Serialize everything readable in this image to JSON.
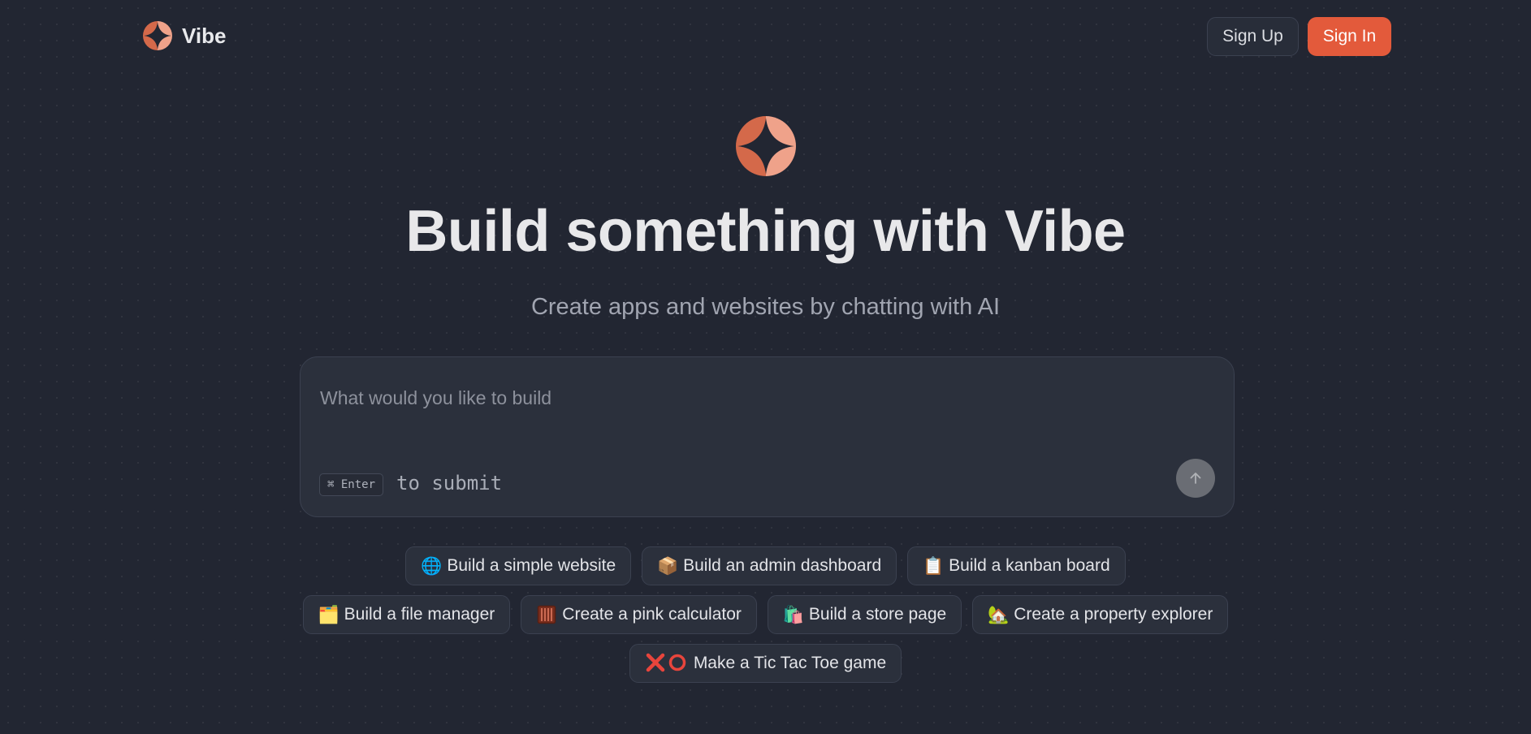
{
  "header": {
    "brand_name": "Vibe",
    "signup_label": "Sign Up",
    "signin_label": "Sign In"
  },
  "hero": {
    "title": "Build something with Vibe",
    "subtitle": "Create apps and websites by chatting with AI"
  },
  "prompt": {
    "placeholder": "What would you like to build",
    "value": "",
    "shortcut_key": "⌘ Enter",
    "shortcut_hint": "to submit"
  },
  "suggestions": [
    {
      "icon": "globe-icon",
      "label": "Build a simple website"
    },
    {
      "icon": "package-icon",
      "label": "Build an admin dashboard"
    },
    {
      "icon": "clipboard-icon",
      "label": "Build a kanban board"
    },
    {
      "icon": "card-index-dividers-icon",
      "label": "Build a file manager"
    },
    {
      "icon": "abacus-icon",
      "label": "Create a pink calculator"
    },
    {
      "icon": "shopping-bags-icon",
      "label": "Build a store page"
    },
    {
      "icon": "house-with-garden-icon",
      "label": "Create a property explorer"
    },
    {
      "icon": "x-and-o-icon",
      "label": "Make a Tic Tac Toe game"
    }
  ],
  "colors": {
    "background": "#222632",
    "accent": "#e35a3b",
    "logo_dark": "#d4694a",
    "logo_light": "#efa28a",
    "card": "#2b303c"
  }
}
